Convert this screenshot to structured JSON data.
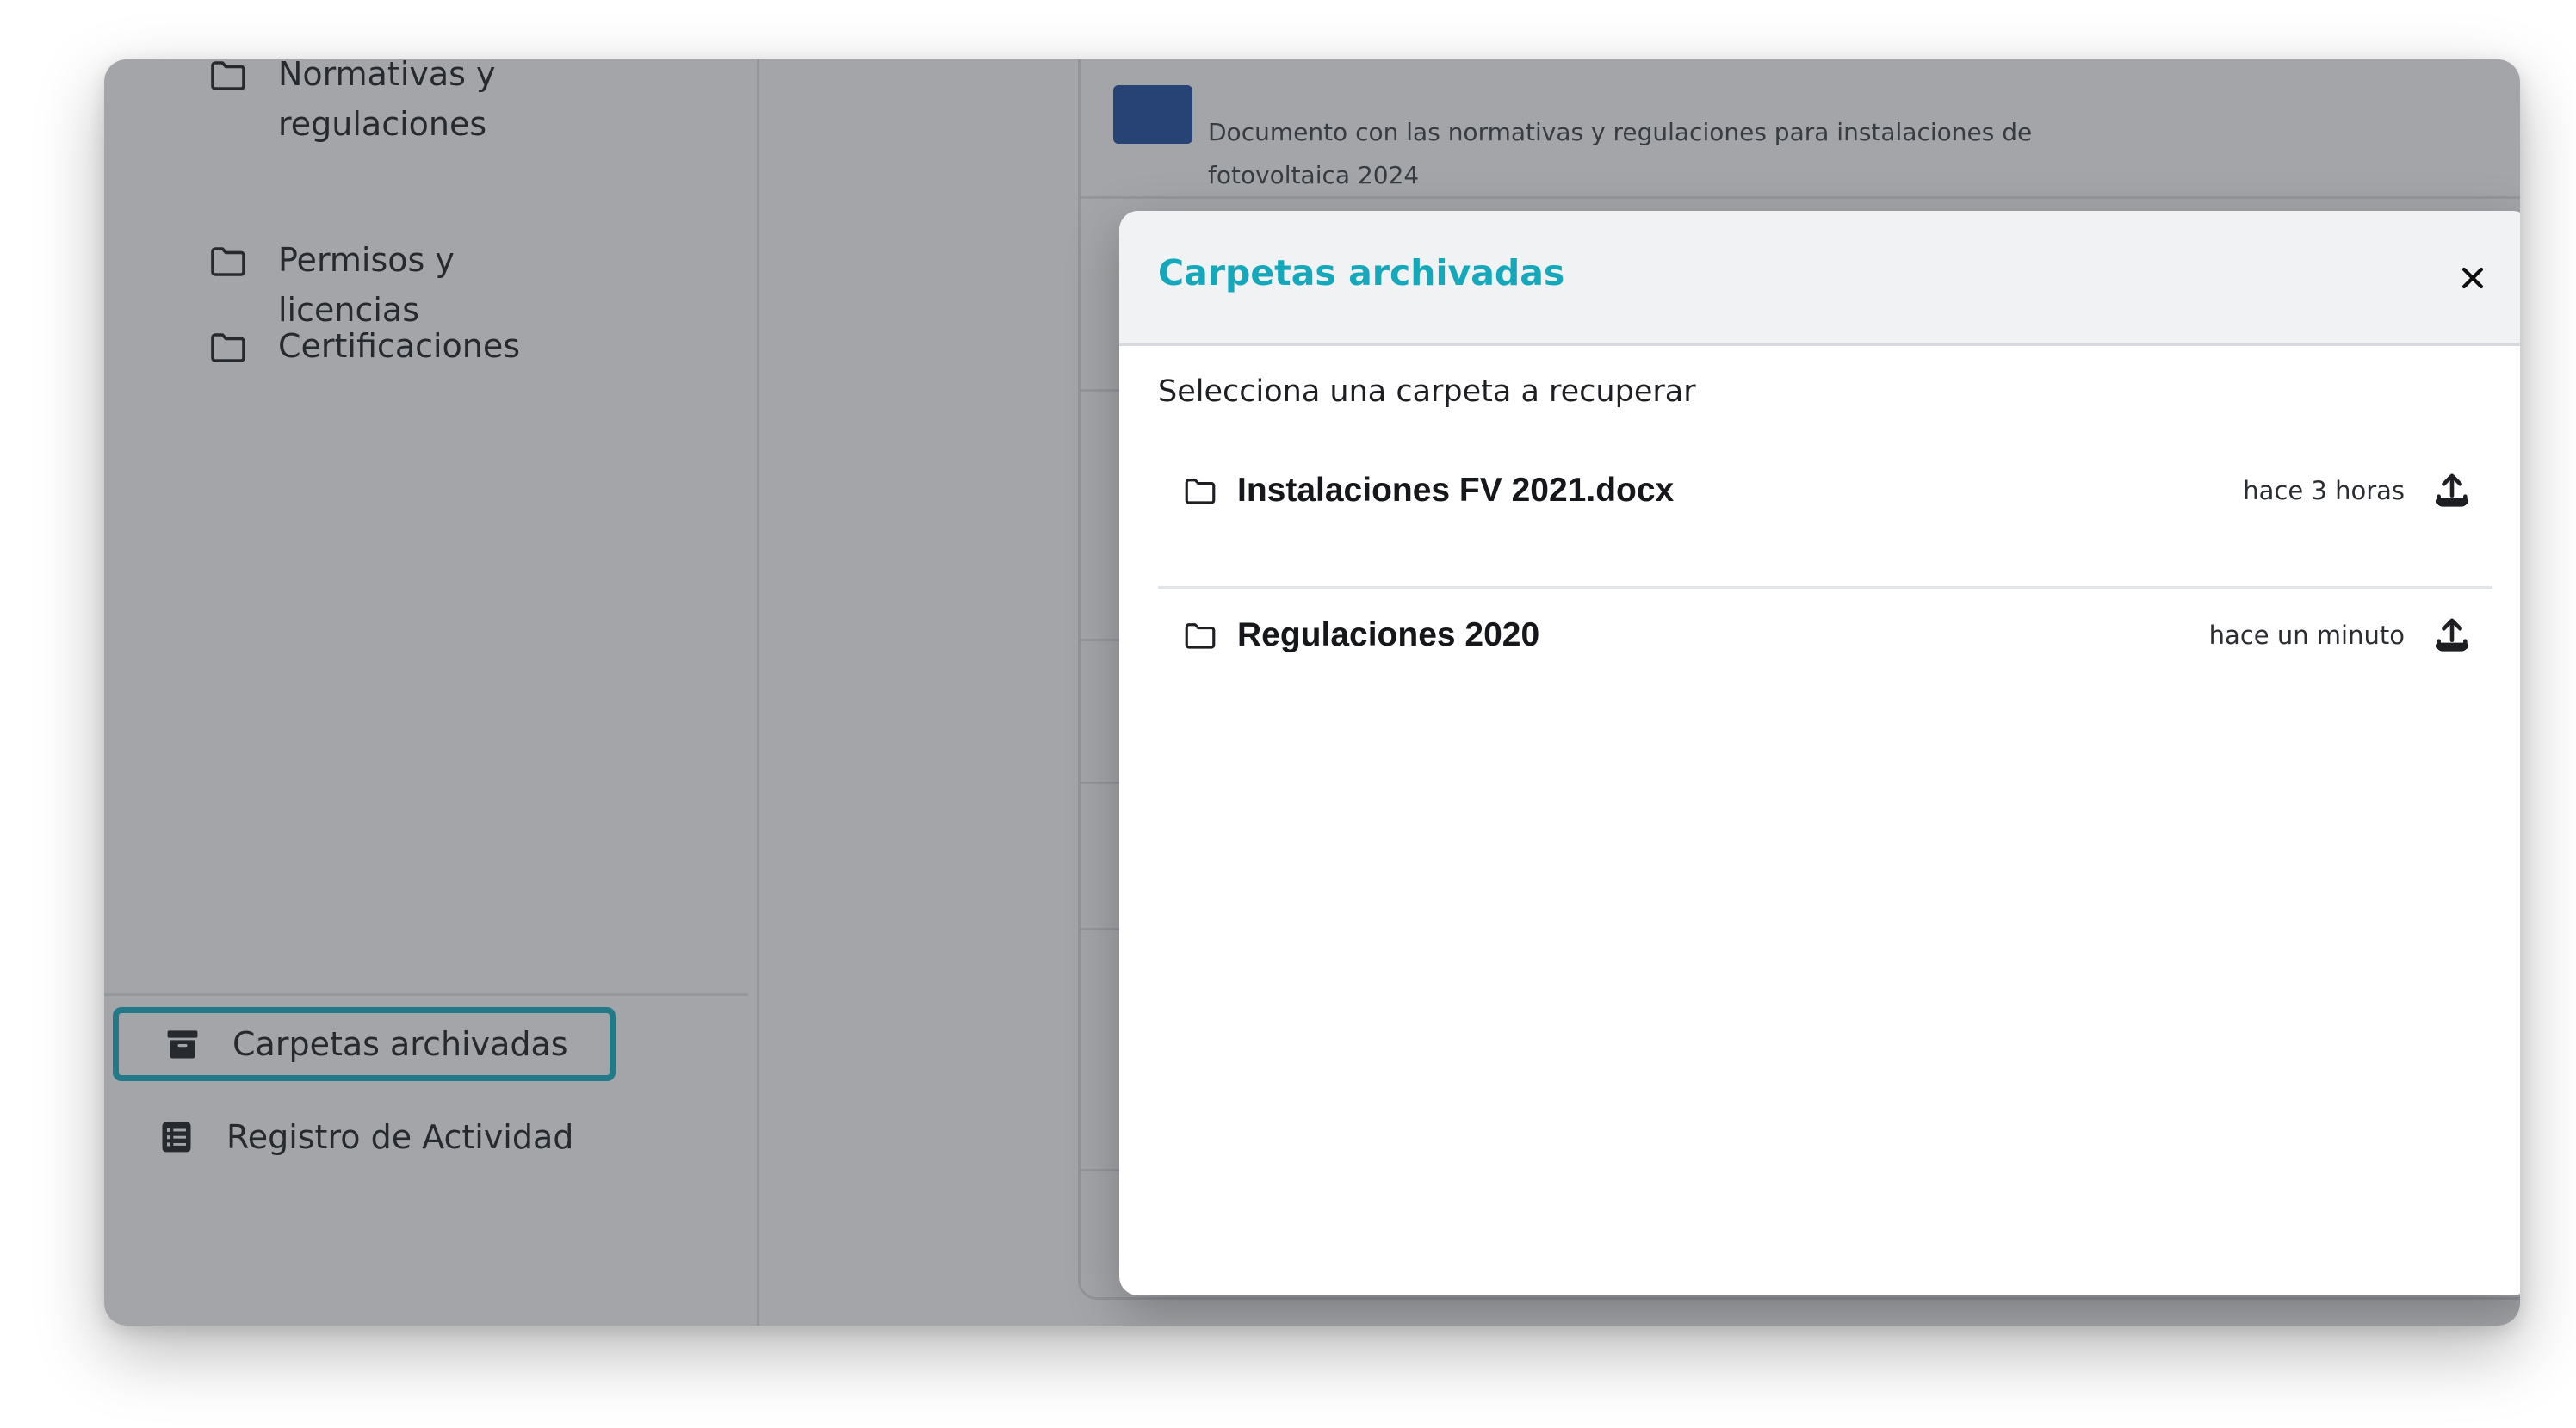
{
  "sidebar": {
    "folders": [
      {
        "label": "Normativas y regulaciones",
        "icon": "folder-icon"
      },
      {
        "label": "Permisos y licencias",
        "icon": "folder-icon"
      },
      {
        "label": "Certificaciones",
        "icon": "folder-icon"
      }
    ],
    "bottom": [
      {
        "label": "Carpetas archivadas",
        "icon": "archive-icon",
        "active": true
      },
      {
        "label": "Registro de Actividad",
        "icon": "list-icon",
        "active": false
      }
    ]
  },
  "main": {
    "document_description": "Documento con las normativas y regulaciones para instalaciones de fotovoltaica 2024"
  },
  "modal": {
    "title": "Carpetas archivadas",
    "instructions": "Selecciona una carpeta a recuperar",
    "items": [
      {
        "name": "Instalaciones FV 2021.docx",
        "time": "hace 3 horas",
        "icon": "folder-icon",
        "action_icon": "upload-icon"
      },
      {
        "name": "Regulaciones 2020",
        "time": "hace un minuto",
        "icon": "folder-icon",
        "action_icon": "upload-icon"
      }
    ]
  },
  "colors": {
    "accent": "#15b1c6",
    "title": "#15a8bb"
  }
}
